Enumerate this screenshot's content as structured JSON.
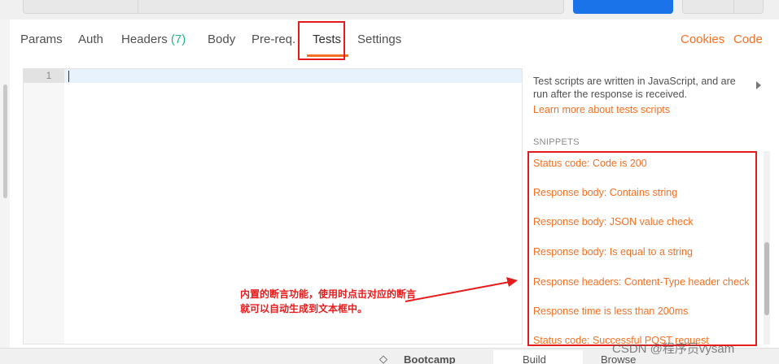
{
  "tabs": {
    "params": "Params",
    "auth": "Auth",
    "headers": "Headers",
    "headers_count": "(7)",
    "body": "Body",
    "prereq": "Pre-req.",
    "tests": "Tests",
    "settings": "Settings",
    "active": "Tests"
  },
  "right_links": {
    "cookies": "Cookies",
    "code": "Code"
  },
  "editor": {
    "line_number": "1",
    "content": ""
  },
  "panel": {
    "description": "Test scripts are written in JavaScript, and are run after the response is received.",
    "learn_link": "Learn more about tests scripts",
    "snippets_title": "SNIPPETS",
    "snippets": [
      "Status code: Code is 200",
      "Response body: Contains string",
      "Response body: JSON value check",
      "Response body: Is equal to a string",
      "Response headers: Content-Type header check",
      "Response time is less than 200ms",
      "Status code: Successful POST request"
    ]
  },
  "annotation": {
    "line1": "内置的断言功能，使用时点击对应的断言",
    "line2": "就可以自动生成到文本框中。"
  },
  "bottom": {
    "bootcamp": "Bootcamp",
    "build": "Build",
    "browse": "Browse"
  },
  "watermark": "CSDN @程序员vysam",
  "colors": {
    "accent": "#f47023",
    "count_green": "#26b47f",
    "send_blue": "#1a73e8",
    "highlight_red": "#e61c1c"
  }
}
